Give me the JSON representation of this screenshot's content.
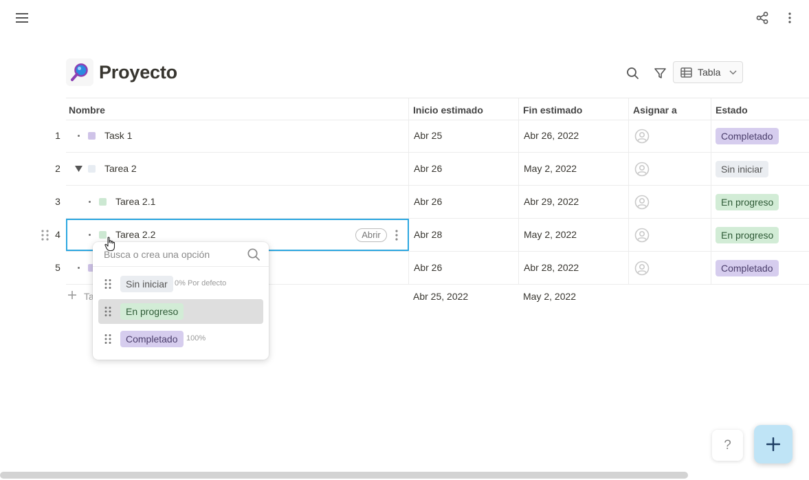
{
  "page": {
    "title": "Proyecto",
    "emoji": "magnifying-glass-icon"
  },
  "toolbar": {
    "view_label": "Tabla"
  },
  "columns": [
    "Nombre",
    "Inicio estimado",
    "Fin estimado",
    "Asignar a",
    "Estado"
  ],
  "rows": [
    {
      "num": "1",
      "name": "Task 1",
      "start": "Abr 25",
      "end": "Abr 26, 2022",
      "status": "Completado",
      "color": "#cfc3e8"
    },
    {
      "num": "2",
      "name": "Tarea 2",
      "start": "Abr 26",
      "end": "May 2, 2022",
      "status": "Sin iniciar",
      "color": "#e7ecf2"
    },
    {
      "num": "3",
      "name": "Tarea 2.1",
      "start": "Abr 26",
      "end": "Abr 29, 2022",
      "status": "En progreso",
      "color": "#cce8d2"
    },
    {
      "num": "4",
      "name": "Tarea 2.2",
      "start": "Abr 28",
      "end": "May 2, 2022",
      "status": "En progreso",
      "color": "#cce8d2"
    },
    {
      "num": "5",
      "name": "",
      "start": "Abr 26",
      "end": "Abr 28, 2022",
      "status": "Completado",
      "color": "#cfc3e8"
    }
  ],
  "row_open_label": "Abrir",
  "add_row": {
    "label": "Ta",
    "start_summary": "Abr 25, 2022",
    "end_summary": "May 2, 2022"
  },
  "status_colors": {
    "completado": "#d6cdee",
    "sin_iniciar": "#eaedf1",
    "en_progreso": "#d2ecd6"
  },
  "dropdown": {
    "placeholder": "Busca o crea una opción",
    "options": [
      {
        "label": "Sin iniciar",
        "meta": "0% Por defecto"
      },
      {
        "label": "En progreso",
        "meta": ""
      },
      {
        "label": "Completado",
        "meta": "100%"
      }
    ]
  },
  "help_label": "?"
}
